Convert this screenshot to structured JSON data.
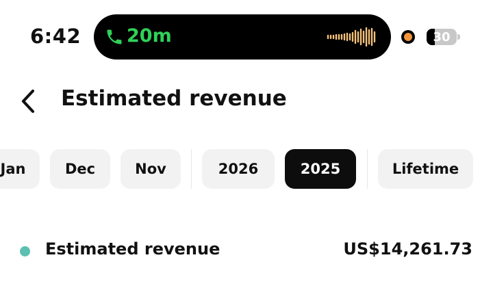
{
  "status_bar": {
    "time": "6:42",
    "call_duration": "20m",
    "battery_level": "30",
    "call_color": "#2fd158",
    "waveform_color": "#f4c27a",
    "recording_dot_color": "#f0953c"
  },
  "header": {
    "back_icon": "chevron-left-icon",
    "title": "Estimated revenue"
  },
  "filters": {
    "months": [
      "Jan",
      "Dec",
      "Nov"
    ],
    "years": [
      "2026",
      "2025"
    ],
    "lifetime": "Lifetime",
    "selected": "2025"
  },
  "metric": {
    "label": "Estimated revenue",
    "value": "US$14,261.73",
    "legend_color": "#5cbfb1"
  }
}
